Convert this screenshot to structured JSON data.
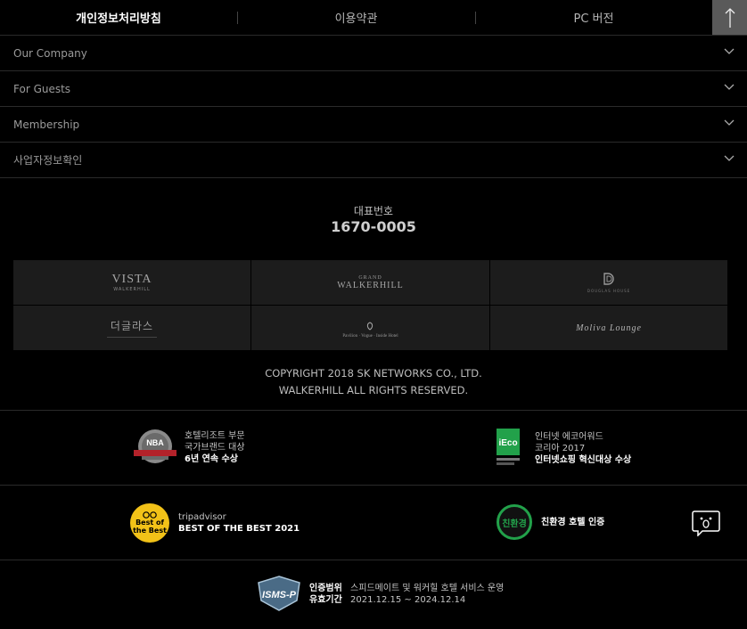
{
  "top_nav": {
    "privacy_label": "개인정보처리방침",
    "terms_label": "이용약관",
    "pc_label": "PC 버전"
  },
  "accordion": [
    {
      "label": "Our Company"
    },
    {
      "label": "For Guests"
    },
    {
      "label": "Membership"
    },
    {
      "label": "사업자정보확인"
    }
  ],
  "contact": {
    "label": "대표번호",
    "phone": "1670-0005"
  },
  "brands": [
    {
      "name": "VISTA",
      "sub": "WALKERHILL"
    },
    {
      "name": "GRAND",
      "sub": "WALKERHILL"
    },
    {
      "name": "D",
      "sub": "DOUGLAS HOUSE"
    },
    {
      "name": "더글라스",
      "sub": ""
    },
    {
      "name": "Pavilion · Vogue · Inside Hotel",
      "sub": ""
    },
    {
      "name": "Moliva Lounge",
      "sub": ""
    }
  ],
  "copyright": {
    "line1": "COPYRIGHT 2018 SK NETWORKS CO., LTD.",
    "line2": "WALKERHILL ALL RIGHTS RESERVED."
  },
  "awards": {
    "nba": {
      "badge": "NBA",
      "line1": "호텔리조트 부문",
      "line2": "국가브랜드 대상",
      "line3": "6년 연속 수상"
    },
    "eco": {
      "badge": "iEco",
      "line1": "인터넷 에코어워드",
      "line2": "코리아 2017",
      "line3": "인터넷쇼핑 혁신대상 수상"
    },
    "trip": {
      "badge_l1": "Best of",
      "badge_l2": "the Best",
      "line1": "tripadvisor",
      "line2": "BEST OF THE BEST 2021"
    },
    "green": {
      "badge": "친환경",
      "line1": "친환경 호텔 인증"
    }
  },
  "isms": {
    "badge": "ISMS-P",
    "k1": "인증범위",
    "v1": "스피드메이트 및 워커힐 호텔 서비스 운영",
    "k2": "유효기간",
    "v2": "2021.12.15 ~ 2024.12.14"
  },
  "colors": {
    "background": "#000000",
    "tile": "#1c1c1c",
    "totop": "#5a5a5a",
    "eco_green": "#22a14a",
    "trip_yellow": "#f2c218",
    "nba_red": "#b3222a"
  },
  "icons": [
    "arrow-up-icon",
    "chevron-down-icon",
    "chat-icon"
  ]
}
